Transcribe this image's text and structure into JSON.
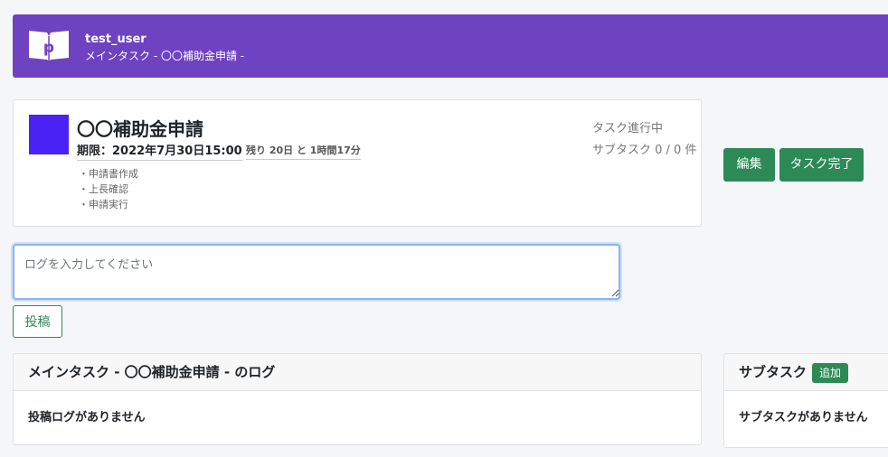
{
  "header": {
    "user_name": "test_user",
    "breadcrumb": "メインタスク - 〇〇補助金申請 -",
    "background_color": "#6f42c1",
    "logo_icon": "book-p-logo-icon"
  },
  "task": {
    "title": "〇〇補助金申請",
    "deadline": "期限：2022年7月30日15:00",
    "remaining": "残り 20日 と 1時間17分",
    "description": [
      "・申請書作成",
      "・上長確認",
      "・申請実行"
    ],
    "status": "タスク進行中",
    "subtask_count": "サブタスク 0 / 0 件",
    "color": "#4a22f5"
  },
  "actions": {
    "edit_label": "編集",
    "complete_label": "タスク完了",
    "button_color": "#2d8a57"
  },
  "log_form": {
    "placeholder": "ログを入力してください",
    "value": "",
    "post_label": "投稿"
  },
  "log_panel": {
    "title": "メインタスク - 〇〇補助金申請 - のログ",
    "empty_message": "投稿ログがありません"
  },
  "subtask_panel": {
    "title": "サブタスク",
    "add_label": "追加",
    "empty_message": "サブタスクがありません"
  }
}
